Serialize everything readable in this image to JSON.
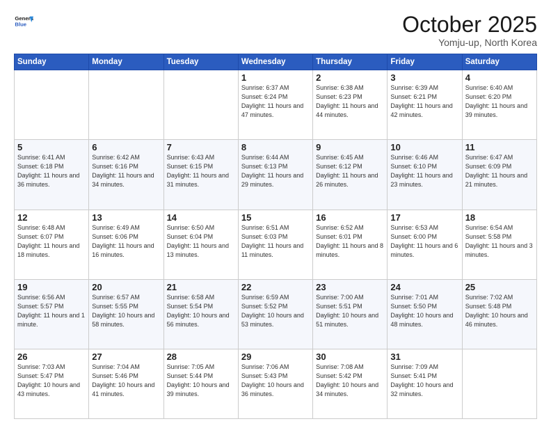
{
  "header": {
    "logo_line1": "General",
    "logo_line2": "Blue",
    "month": "October 2025",
    "location": "Yomju-up, North Korea"
  },
  "days_of_week": [
    "Sunday",
    "Monday",
    "Tuesday",
    "Wednesday",
    "Thursday",
    "Friday",
    "Saturday"
  ],
  "weeks": [
    [
      {
        "day": "",
        "info": ""
      },
      {
        "day": "",
        "info": ""
      },
      {
        "day": "",
        "info": ""
      },
      {
        "day": "1",
        "info": "Sunrise: 6:37 AM\nSunset: 6:24 PM\nDaylight: 11 hours\nand 47 minutes."
      },
      {
        "day": "2",
        "info": "Sunrise: 6:38 AM\nSunset: 6:23 PM\nDaylight: 11 hours\nand 44 minutes."
      },
      {
        "day": "3",
        "info": "Sunrise: 6:39 AM\nSunset: 6:21 PM\nDaylight: 11 hours\nand 42 minutes."
      },
      {
        "day": "4",
        "info": "Sunrise: 6:40 AM\nSunset: 6:20 PM\nDaylight: 11 hours\nand 39 minutes."
      }
    ],
    [
      {
        "day": "5",
        "info": "Sunrise: 6:41 AM\nSunset: 6:18 PM\nDaylight: 11 hours\nand 36 minutes."
      },
      {
        "day": "6",
        "info": "Sunrise: 6:42 AM\nSunset: 6:16 PM\nDaylight: 11 hours\nand 34 minutes."
      },
      {
        "day": "7",
        "info": "Sunrise: 6:43 AM\nSunset: 6:15 PM\nDaylight: 11 hours\nand 31 minutes."
      },
      {
        "day": "8",
        "info": "Sunrise: 6:44 AM\nSunset: 6:13 PM\nDaylight: 11 hours\nand 29 minutes."
      },
      {
        "day": "9",
        "info": "Sunrise: 6:45 AM\nSunset: 6:12 PM\nDaylight: 11 hours\nand 26 minutes."
      },
      {
        "day": "10",
        "info": "Sunrise: 6:46 AM\nSunset: 6:10 PM\nDaylight: 11 hours\nand 23 minutes."
      },
      {
        "day": "11",
        "info": "Sunrise: 6:47 AM\nSunset: 6:09 PM\nDaylight: 11 hours\nand 21 minutes."
      }
    ],
    [
      {
        "day": "12",
        "info": "Sunrise: 6:48 AM\nSunset: 6:07 PM\nDaylight: 11 hours\nand 18 minutes."
      },
      {
        "day": "13",
        "info": "Sunrise: 6:49 AM\nSunset: 6:06 PM\nDaylight: 11 hours\nand 16 minutes."
      },
      {
        "day": "14",
        "info": "Sunrise: 6:50 AM\nSunset: 6:04 PM\nDaylight: 11 hours\nand 13 minutes."
      },
      {
        "day": "15",
        "info": "Sunrise: 6:51 AM\nSunset: 6:03 PM\nDaylight: 11 hours\nand 11 minutes."
      },
      {
        "day": "16",
        "info": "Sunrise: 6:52 AM\nSunset: 6:01 PM\nDaylight: 11 hours\nand 8 minutes."
      },
      {
        "day": "17",
        "info": "Sunrise: 6:53 AM\nSunset: 6:00 PM\nDaylight: 11 hours\nand 6 minutes."
      },
      {
        "day": "18",
        "info": "Sunrise: 6:54 AM\nSunset: 5:58 PM\nDaylight: 11 hours\nand 3 minutes."
      }
    ],
    [
      {
        "day": "19",
        "info": "Sunrise: 6:56 AM\nSunset: 5:57 PM\nDaylight: 11 hours\nand 1 minute."
      },
      {
        "day": "20",
        "info": "Sunrise: 6:57 AM\nSunset: 5:55 PM\nDaylight: 10 hours\nand 58 minutes."
      },
      {
        "day": "21",
        "info": "Sunrise: 6:58 AM\nSunset: 5:54 PM\nDaylight: 10 hours\nand 56 minutes."
      },
      {
        "day": "22",
        "info": "Sunrise: 6:59 AM\nSunset: 5:52 PM\nDaylight: 10 hours\nand 53 minutes."
      },
      {
        "day": "23",
        "info": "Sunrise: 7:00 AM\nSunset: 5:51 PM\nDaylight: 10 hours\nand 51 minutes."
      },
      {
        "day": "24",
        "info": "Sunrise: 7:01 AM\nSunset: 5:50 PM\nDaylight: 10 hours\nand 48 minutes."
      },
      {
        "day": "25",
        "info": "Sunrise: 7:02 AM\nSunset: 5:48 PM\nDaylight: 10 hours\nand 46 minutes."
      }
    ],
    [
      {
        "day": "26",
        "info": "Sunrise: 7:03 AM\nSunset: 5:47 PM\nDaylight: 10 hours\nand 43 minutes."
      },
      {
        "day": "27",
        "info": "Sunrise: 7:04 AM\nSunset: 5:46 PM\nDaylight: 10 hours\nand 41 minutes."
      },
      {
        "day": "28",
        "info": "Sunrise: 7:05 AM\nSunset: 5:44 PM\nDaylight: 10 hours\nand 39 minutes."
      },
      {
        "day": "29",
        "info": "Sunrise: 7:06 AM\nSunset: 5:43 PM\nDaylight: 10 hours\nand 36 minutes."
      },
      {
        "day": "30",
        "info": "Sunrise: 7:08 AM\nSunset: 5:42 PM\nDaylight: 10 hours\nand 34 minutes."
      },
      {
        "day": "31",
        "info": "Sunrise: 7:09 AM\nSunset: 5:41 PM\nDaylight: 10 hours\nand 32 minutes."
      },
      {
        "day": "",
        "info": ""
      }
    ]
  ]
}
